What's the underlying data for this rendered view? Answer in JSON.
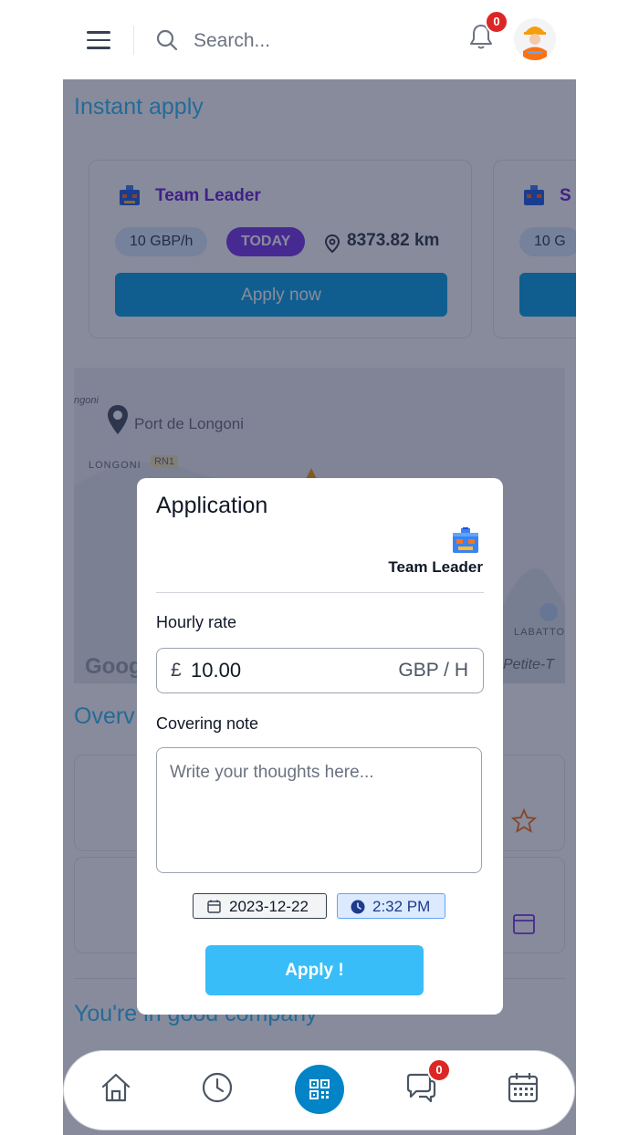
{
  "header": {
    "search_placeholder": "Search...",
    "notification_count": "0"
  },
  "page": {
    "instant_apply_title": "Instant apply",
    "job_cards": [
      {
        "title": "Team Leader",
        "rate": "10 GBP/h",
        "when": "TODAY",
        "distance": "8373.82 km",
        "button": "Apply now"
      },
      {
        "title": "S",
        "rate": "10 G"
      }
    ],
    "map": {
      "place": "Port de Longoni",
      "area": "LONGONI",
      "road": "RN1",
      "corner": "ngoni",
      "area_right": "LABATTO",
      "place_right": "Petite-T",
      "provider": "Goog"
    },
    "overview_title": "Overv",
    "company_title": "You're in good company"
  },
  "bottom_nav": {
    "chat_count": "0"
  },
  "modal": {
    "title": "Application",
    "job_name": "Team Leader",
    "hourly_rate_label": "Hourly rate",
    "currency_symbol": "£",
    "rate_value": "10.00",
    "rate_unit": "GBP / H",
    "covering_note_label": "Covering note",
    "note_placeholder": "Write your thoughts here...",
    "date": "2023-12-22",
    "time": "2:32 PM",
    "apply_label": "Apply !"
  }
}
